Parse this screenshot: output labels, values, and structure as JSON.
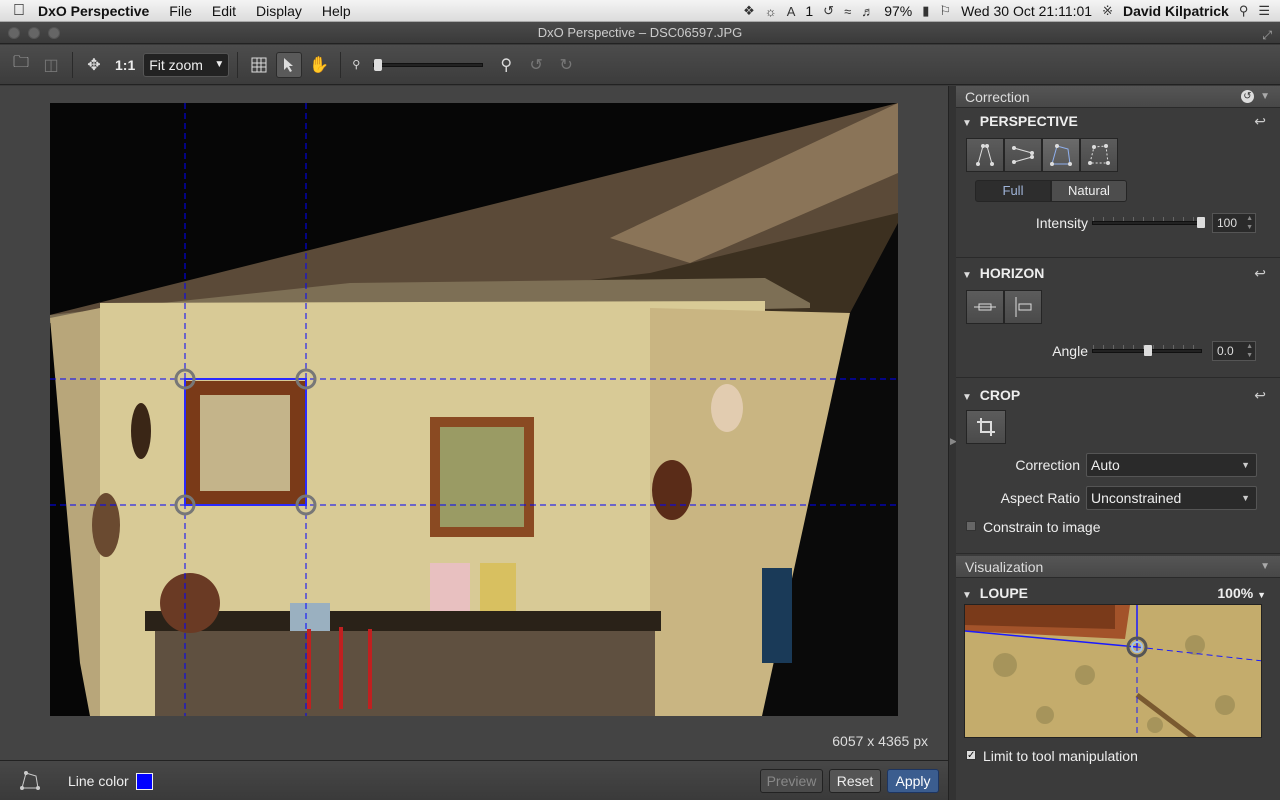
{
  "menubar": {
    "app_name": "DxO Perspective",
    "menus": [
      "File",
      "Edit",
      "Display",
      "Help"
    ],
    "status": {
      "adobe_count": "1",
      "battery": "97%",
      "datetime": "Wed 30 Oct  21:11:01",
      "user": "David Kilpatrick"
    }
  },
  "window": {
    "title": "DxO Perspective – DSC06597.JPG"
  },
  "toolbar": {
    "actual_size_label": "1:1",
    "zoom_value": "Fit zoom"
  },
  "canvas": {
    "image_size": "6057 x 4365 px",
    "line_color": "#0000ff"
  },
  "bottom": {
    "line_color_label": "Line color",
    "preview_label": "Preview",
    "reset_label": "Reset",
    "apply_label": "Apply"
  },
  "panel": {
    "correction_title": "Correction",
    "perspective": {
      "title": "PERSPECTIVE",
      "mode_full": "Full",
      "mode_natural": "Natural",
      "selected_mode": "Full",
      "intensity_label": "Intensity",
      "intensity_value": "100"
    },
    "horizon": {
      "title": "HORIZON",
      "angle_label": "Angle",
      "angle_value": "0.0"
    },
    "crop": {
      "title": "CROP",
      "correction_label": "Correction",
      "correction_value": "Auto",
      "aspect_label": "Aspect Ratio",
      "aspect_value": "Unconstrained",
      "constrain_label": "Constrain to image",
      "constrain_checked": false
    },
    "visualization_title": "Visualization",
    "loupe": {
      "title": "LOUPE",
      "zoom": "100%",
      "limit_label": "Limit to tool manipulation",
      "limit_checked": true
    }
  }
}
